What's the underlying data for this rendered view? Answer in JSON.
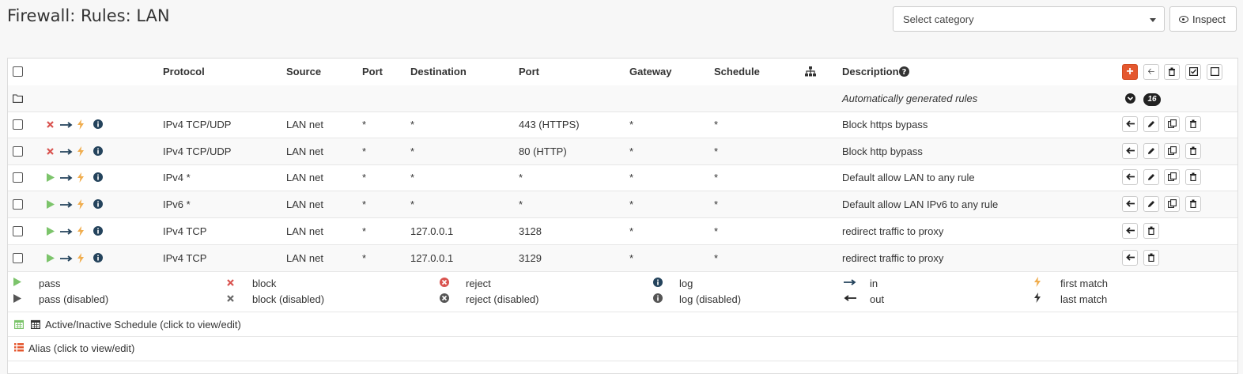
{
  "page": {
    "title": "Firewall: Rules: LAN"
  },
  "toolbar": {
    "category_placeholder": "Select category",
    "inspect_label": "Inspect"
  },
  "table": {
    "headers": {
      "protocol": "Protocol",
      "source": "Source",
      "port": "Port",
      "destination": "Destination",
      "dest_port": "Port",
      "gateway": "Gateway",
      "schedule": "Schedule",
      "description": "Description"
    },
    "auto_row": {
      "description": "Automatically generated rules",
      "count": "16"
    },
    "rules": [
      {
        "action": "block",
        "protocol": "IPv4 TCP/UDP",
        "source": "LAN net",
        "port": "*",
        "destination": "*",
        "dest_port": "443 (HTTPS)",
        "gateway": "*",
        "schedule": "*",
        "description": "Block https bypass"
      },
      {
        "action": "block",
        "protocol": "IPv4 TCP/UDP",
        "source": "LAN net",
        "port": "*",
        "destination": "*",
        "dest_port": "80 (HTTP)",
        "gateway": "*",
        "schedule": "*",
        "description": "Block http bypass"
      },
      {
        "action": "pass",
        "protocol": "IPv4 *",
        "source": "LAN net",
        "port": "*",
        "destination": "*",
        "dest_port": "*",
        "gateway": "*",
        "schedule": "*",
        "description": "Default allow LAN to any rule"
      },
      {
        "action": "pass",
        "protocol": "IPv6 *",
        "source": "LAN net",
        "port": "*",
        "destination": "*",
        "dest_port": "*",
        "gateway": "*",
        "schedule": "*",
        "description": "Default allow LAN IPv6 to any rule"
      },
      {
        "action": "pass",
        "protocol": "IPv4 TCP",
        "source": "LAN net",
        "port": "*",
        "destination": "127.0.0.1",
        "dest_port": "3128",
        "gateway": "*",
        "schedule": "*",
        "description": "redirect traffic to proxy"
      },
      {
        "action": "pass",
        "protocol": "IPv4 TCP",
        "source": "LAN net",
        "port": "*",
        "destination": "127.0.0.1",
        "dest_port": "3129",
        "gateway": "*",
        "schedule": "*",
        "description": "redirect traffic to proxy"
      }
    ]
  },
  "legend": {
    "pass": "pass",
    "pass_disabled": "pass (disabled)",
    "block": "block",
    "block_disabled": "block (disabled)",
    "reject": "reject",
    "reject_disabled": "reject (disabled)",
    "log": "log",
    "log_disabled": "log (disabled)",
    "in": "in",
    "out": "out",
    "first_match": "first match",
    "last_match": "last match",
    "schedule_note": "Active/Inactive Schedule (click to view/edit)",
    "alias_note": "Alias (click to view/edit)"
  },
  "colors": {
    "pass": "#7cc46b",
    "block": "#d9534f",
    "accent": "#e4572e",
    "bolt": "#f0ad4e",
    "arrow": "#24435c"
  }
}
